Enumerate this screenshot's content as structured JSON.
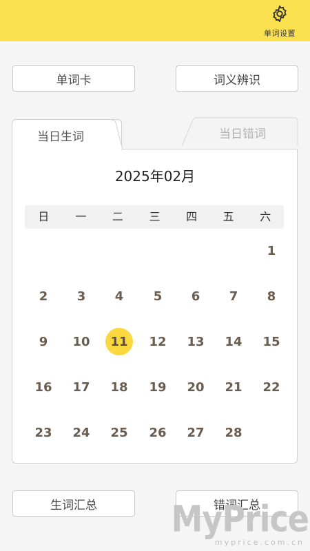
{
  "header": {
    "settings_label": "单词设置",
    "accent_color": "#fbe04f"
  },
  "buttons": {
    "word_card": "单词卡",
    "meaning_identify": "词义辨识",
    "new_words_summary": "生词汇总",
    "wrong_words_summary": "错词汇总"
  },
  "tabs": {
    "active": "当日生词",
    "inactive": "当日错词"
  },
  "calendar": {
    "month_title": "2025年02月",
    "weekdays": [
      "日",
      "一",
      "二",
      "三",
      "四",
      "五",
      "六"
    ],
    "selected_day": "11",
    "weeks": [
      [
        "",
        "",
        "",
        "",
        "",
        "",
        "1"
      ],
      [
        "2",
        "3",
        "4",
        "5",
        "6",
        "7",
        "8"
      ],
      [
        "9",
        "10",
        "11",
        "12",
        "13",
        "14",
        "15"
      ],
      [
        "16",
        "17",
        "18",
        "19",
        "20",
        "21",
        "22"
      ],
      [
        "23",
        "24",
        "25",
        "26",
        "27",
        "28",
        ""
      ]
    ]
  },
  "watermark": {
    "brand": "MyPrice",
    "domain": "myprice.com.cn"
  }
}
